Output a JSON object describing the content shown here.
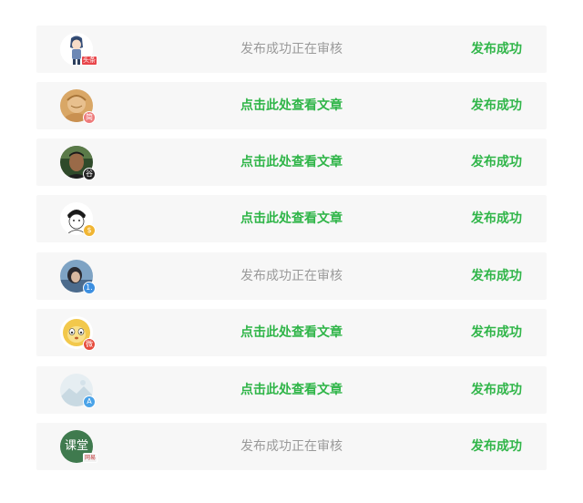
{
  "colors": {
    "row_bg": "#f7f7f7",
    "success_green": "#2fb548",
    "pending_gray": "#9a9a9a"
  },
  "rows": [
    {
      "avatar_icon": "anime-girl-icon",
      "badge_text": "头条",
      "badge_color": "#e8454a",
      "middle_text": "发布成功正在审核",
      "middle_kind": "pending",
      "status_text": "发布成功"
    },
    {
      "avatar_icon": "sketch-portrait-icon",
      "badge_text": "简",
      "badge_color": "#ee7a7a",
      "middle_text": "点击此处查看文章",
      "middle_kind": "link",
      "status_text": "发布成功"
    },
    {
      "avatar_icon": "man-photo-icon",
      "badge_text": "谷",
      "badge_color": "#222222",
      "middle_text": "点击此处查看文章",
      "middle_kind": "link",
      "status_text": "发布成功"
    },
    {
      "avatar_icon": "cartoon-girl-icon",
      "badge_text": "$",
      "badge_color": "#f0b533",
      "middle_text": "点击此处查看文章",
      "middle_kind": "link",
      "status_text": "发布成功"
    },
    {
      "avatar_icon": "blue-portrait-icon",
      "badge_text": "1.",
      "badge_color": "#3d8fe0",
      "middle_text": "发布成功正在审核",
      "middle_kind": "pending",
      "status_text": "发布成功"
    },
    {
      "avatar_icon": "lion-cartoon-icon",
      "badge_text": "微",
      "badge_color": "#e64b3c",
      "middle_text": "点击此处查看文章",
      "middle_kind": "link",
      "status_text": "发布成功"
    },
    {
      "avatar_icon": "landscape-placeholder-icon",
      "badge_text": "A",
      "badge_color": "#4aa3e8",
      "middle_text": "点击此处查看文章",
      "middle_kind": "link",
      "status_text": "发布成功"
    },
    {
      "avatar_icon": "ketang-logo-icon",
      "avatar_text": "课堂",
      "badge_text": "网易",
      "badge_color": "#f2f2f2",
      "middle_text": "发布成功正在审核",
      "middle_kind": "pending",
      "status_text": "发布成功"
    }
  ]
}
